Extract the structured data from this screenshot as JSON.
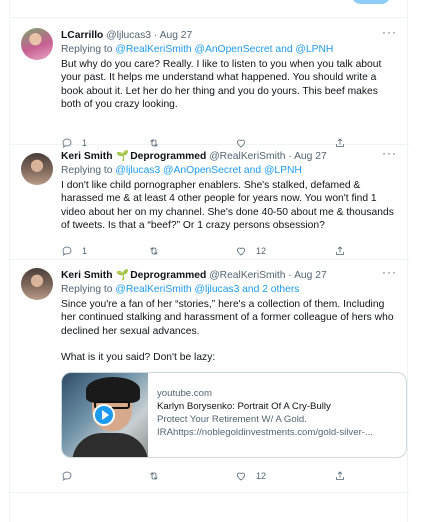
{
  "tweets": [
    {
      "name": "LCarrillo",
      "handle": "@ljlucas3",
      "dot": "·",
      "date": "Aug 27",
      "more": "···",
      "replying_prefix": "Replying to",
      "replying_to": "@RealKeriSmith @AnOpenSecret and @LPNH",
      "paragraphs": [
        "But why do you care? Really. I like to listen to you when you talk about your past. It helps me understand what happened. You should write a book about it. Let her do her thing and you do yours. This beef makes both of you crazy looking."
      ],
      "actions": {
        "replies": "1",
        "retweets": "",
        "likes": ""
      }
    },
    {
      "name": "Keri Smith",
      "sprout": "🌱",
      "name_suffix": "Deprogrammed",
      "handle": "@RealKeriSmith",
      "dot": "·",
      "date": "Aug 27",
      "more": "···",
      "replying_prefix": "Replying to",
      "replying_to": "@ljlucas3 @AnOpenSecret and @LPNH",
      "paragraphs": [
        "I don't like child pornographer enablers. She's stalked, defamed & harassed me & at least 4 other people for years now. You won't find 1 video about her on my channel. She's done 40-50 about me & thousands of tweets. Is that a “beef?” Or 1 crazy persons obsession?"
      ],
      "actions": {
        "replies": "1",
        "retweets": "",
        "likes": "12"
      }
    },
    {
      "name": "Keri Smith",
      "sprout": "🌱",
      "name_suffix": "Deprogrammed",
      "handle": "@RealKeriSmith",
      "dot": "·",
      "date": "Aug 27",
      "more": "···",
      "replying_prefix": "Replying to",
      "replying_to": "@RealKeriSmith @ljlucas3 and 2 others",
      "paragraphs": [
        "Since you're a fan of her “stories,” here's a collection of them. Including her continued stalking and harassment of a former colleague of hers who declined her sexual advances.",
        "What is it you said? Don't be lazy:"
      ],
      "card": {
        "domain": "youtube.com",
        "title": "Karlyn Borysenko: Portrait Of A Cry-Bully",
        "description_line1": "Protect Your Retirement W/ A Gold.",
        "description_line2": "IRAhttps://noblegoldinvestments.com/gold-silver-..."
      },
      "actions": {
        "replies": "",
        "retweets": "",
        "likes": "12"
      }
    }
  ],
  "icons": {
    "reply": "reply-icon",
    "retweet": "retweet-icon",
    "like": "heart-icon",
    "share": "share-icon",
    "more": "more-icon",
    "play": "play-icon"
  },
  "colors": {
    "link": "#1d9bf0",
    "muted": "#536471",
    "border": "#eff3f4",
    "text": "#0f1419"
  }
}
